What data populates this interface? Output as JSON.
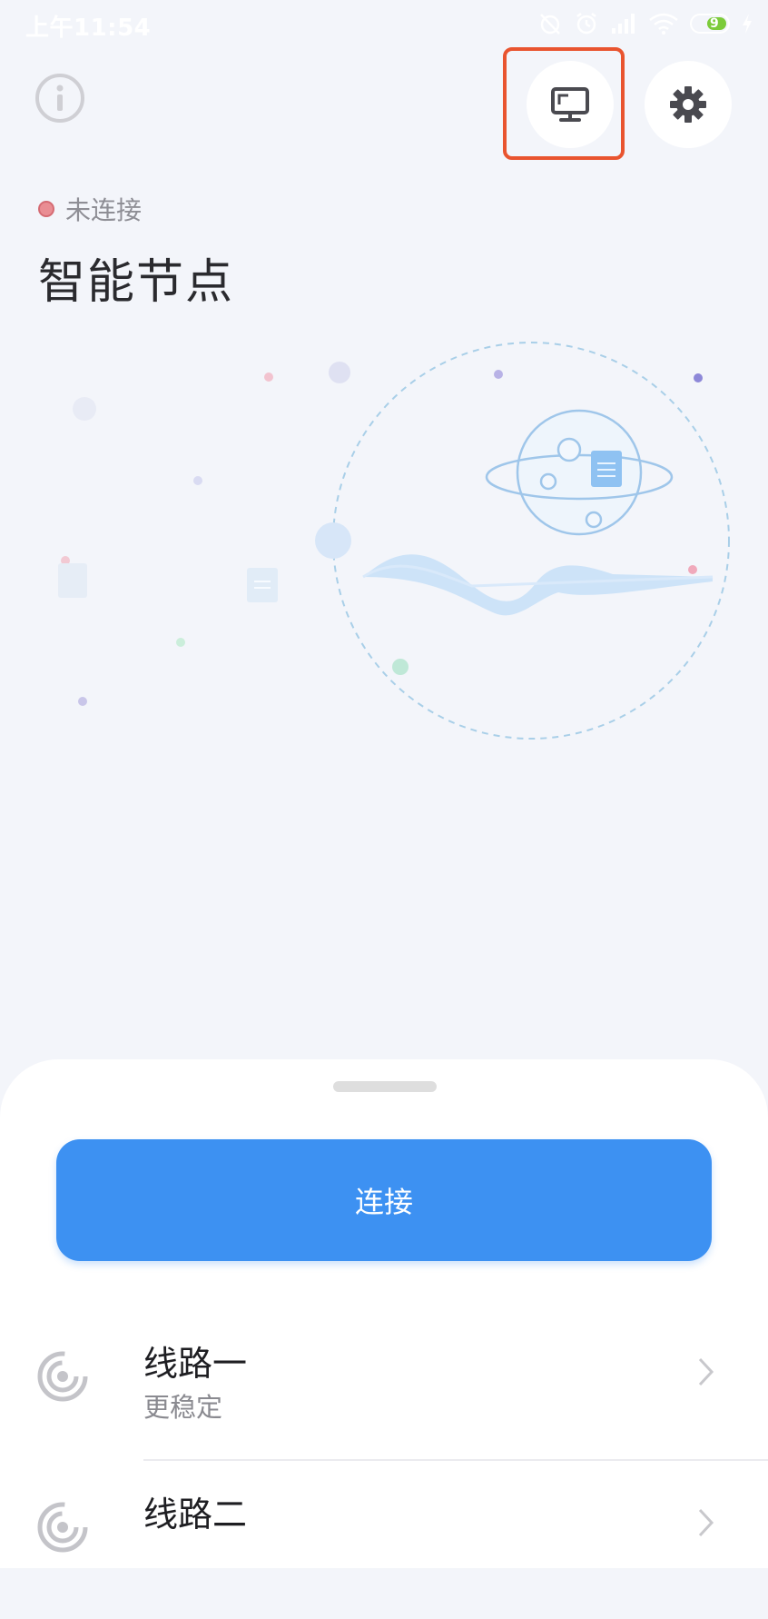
{
  "status_bar": {
    "time": "上午11:54",
    "battery": "9",
    "icons": [
      "alarm-off-icon",
      "alarm-clock-icon",
      "signal-icon",
      "wifi-icon",
      "battery-icon",
      "charging-icon"
    ]
  },
  "header": {
    "info_icon": "info-icon",
    "monitor_icon": "monitor-icon",
    "settings_icon": "gear-icon"
  },
  "connection": {
    "status": "未连接",
    "node_name": "智能节点"
  },
  "sheet": {
    "connect_label": "连接",
    "routes": [
      {
        "title": "线路一",
        "subtitle": "更稳定",
        "icon": "route-signal-icon"
      },
      {
        "title": "线路二",
        "icon": "route-signal-icon"
      }
    ]
  },
  "colors": {
    "accent": "#3d91f2",
    "background": "#f3f5fa",
    "highlight": "#e9542f",
    "status_dot": "#e98d93"
  }
}
